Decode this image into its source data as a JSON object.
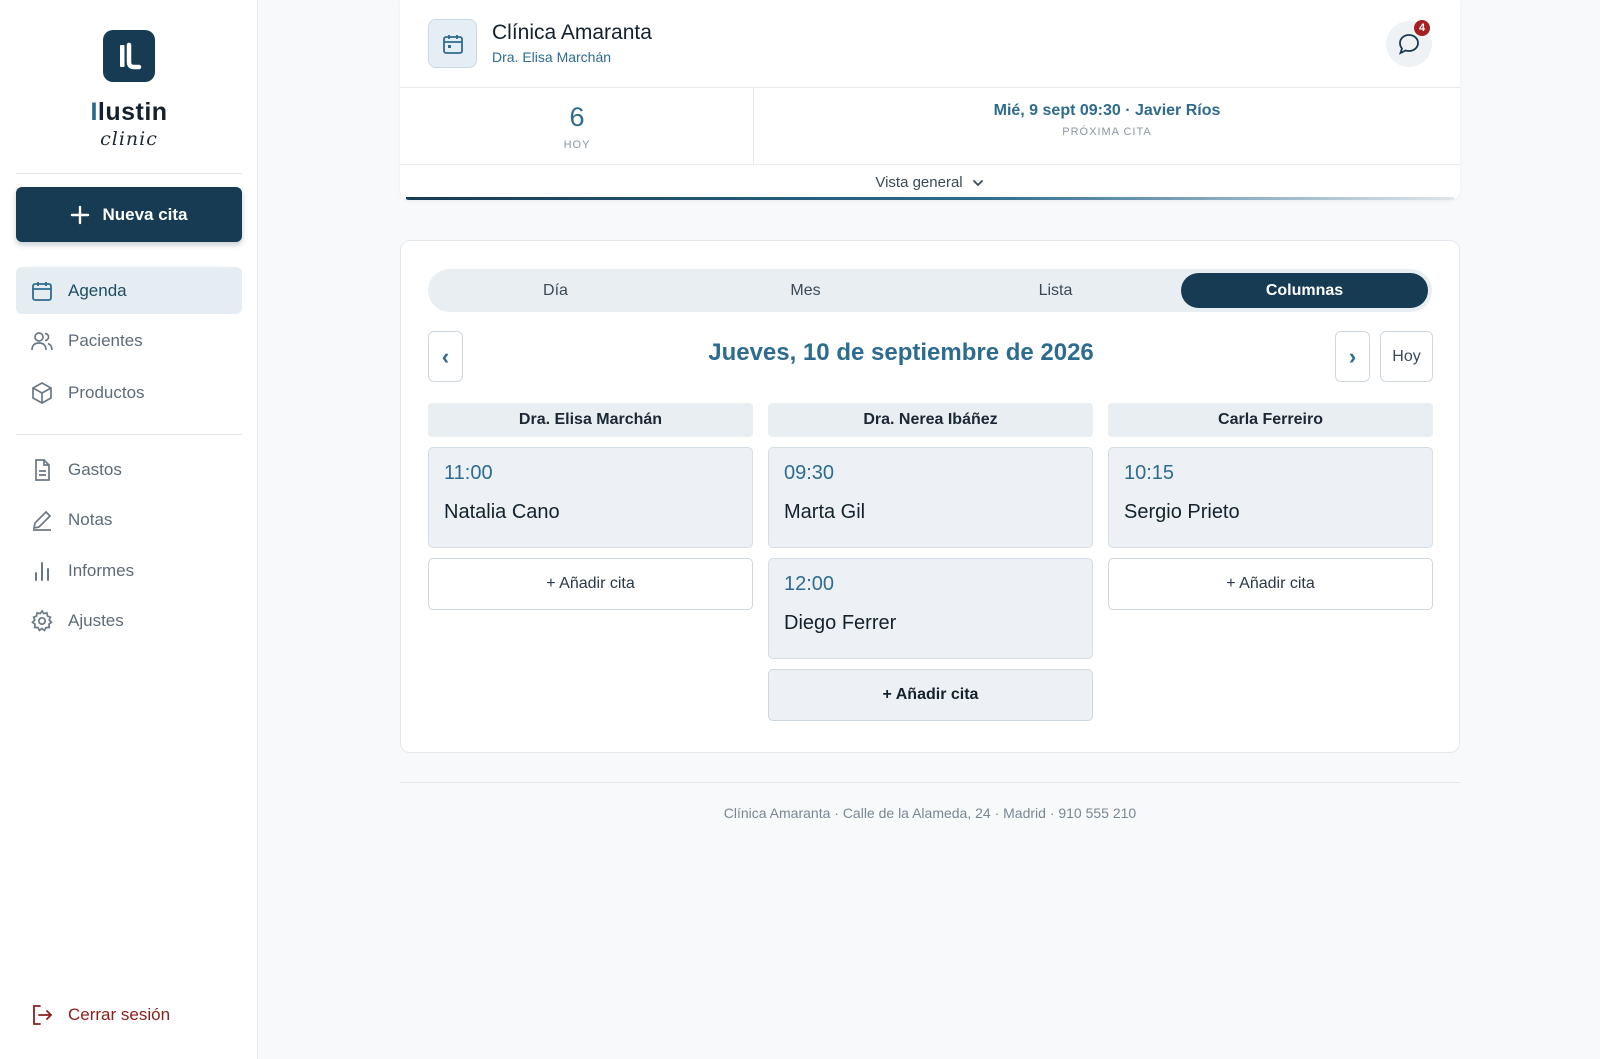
{
  "brand": {
    "word_lead": "I",
    "word_rest": "lustin",
    "sub": "clinic"
  },
  "sidebar": {
    "new_button": "Nueva cita",
    "items": [
      {
        "label": "Agenda",
        "icon": "calendar-icon",
        "active": true
      },
      {
        "label": "Pacientes",
        "icon": "users-icon"
      },
      {
        "label": "Productos",
        "icon": "box-icon"
      },
      {
        "label": "Gastos",
        "icon": "document-icon"
      },
      {
        "label": "Notas",
        "icon": "pen-icon"
      },
      {
        "label": "Informes",
        "icon": "bar-chart-icon"
      },
      {
        "label": "Ajustes",
        "icon": "gear-icon"
      }
    ],
    "logout": "Cerrar sesión"
  },
  "header": {
    "clinic_name": "Clínica Amaranta",
    "doctor": "Dra. Elisa Marchán",
    "notifications": "4",
    "today_count": "6",
    "today_label": "HOY",
    "next_appointment": "Mié, 9 sept 09:30 · Javier Ríos",
    "next_label": "PRÓXIMA CITA",
    "overview": "Vista general"
  },
  "calendar": {
    "tabs": [
      "Día",
      "Mes",
      "Lista",
      "Columnas"
    ],
    "active_tab": "Columnas",
    "prev": "‹",
    "next": "›",
    "date": "Jueves, 10 de septiembre de 2026",
    "today_button": "Hoy",
    "columns": [
      {
        "name": "Dra. Elisa Marchán",
        "appointments": [
          {
            "time": "11:00",
            "patient": "Natalia Cano"
          }
        ],
        "add": "+ Añadir cita"
      },
      {
        "name": "Dra. Nerea Ibáñez",
        "appointments": [
          {
            "time": "09:30",
            "patient": "Marta Gil"
          },
          {
            "time": "12:00",
            "patient": "Diego Ferrer"
          }
        ],
        "add": "+ Añadir cita"
      },
      {
        "name": "Carla Ferreiro",
        "appointments": [
          {
            "time": "10:15",
            "patient": "Sergio Prieto"
          }
        ],
        "add": "+ Añadir cita"
      }
    ]
  },
  "footer": "Clínica Amaranta · Calle de la Alameda, 24 · Madrid · 910 555 210",
  "colors": {
    "primary": "#173b52",
    "accent": "#2d6c8e",
    "danger": "#a32121"
  }
}
